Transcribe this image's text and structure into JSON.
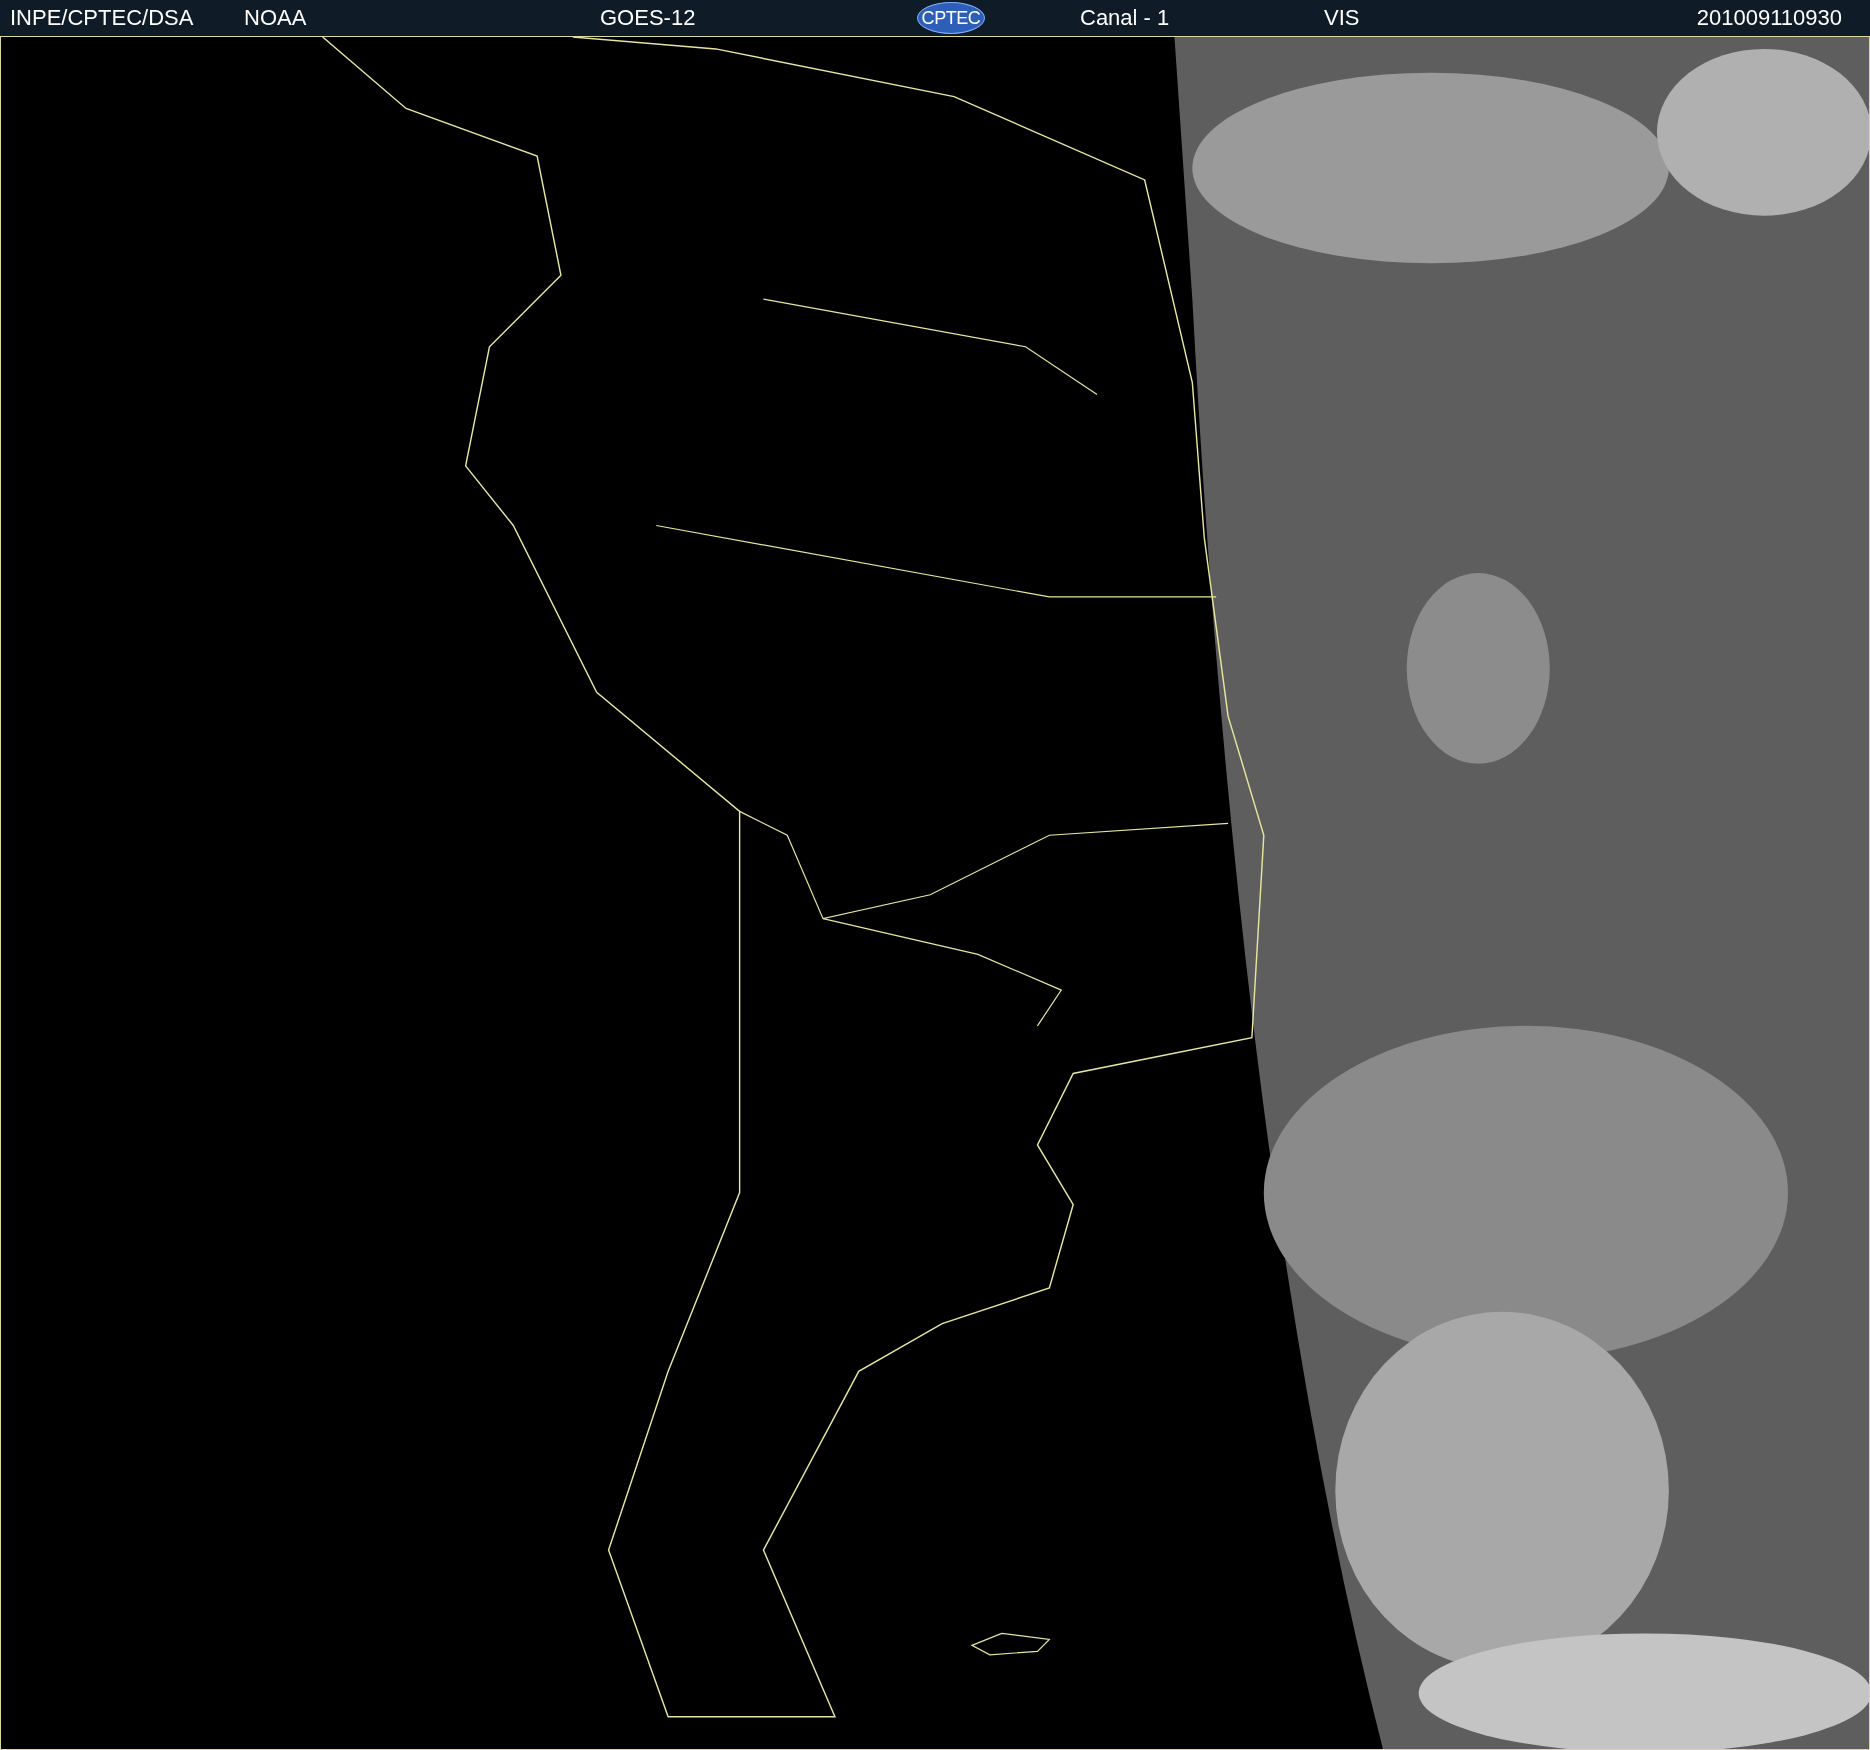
{
  "header": {
    "source": "INPE/CPTEC/DSA",
    "agency": "NOAA",
    "satellite": "GOES-12",
    "logo": "CPTEC",
    "channel": "Canal - 1",
    "band": "VIS",
    "timestamp": "201009110930"
  }
}
